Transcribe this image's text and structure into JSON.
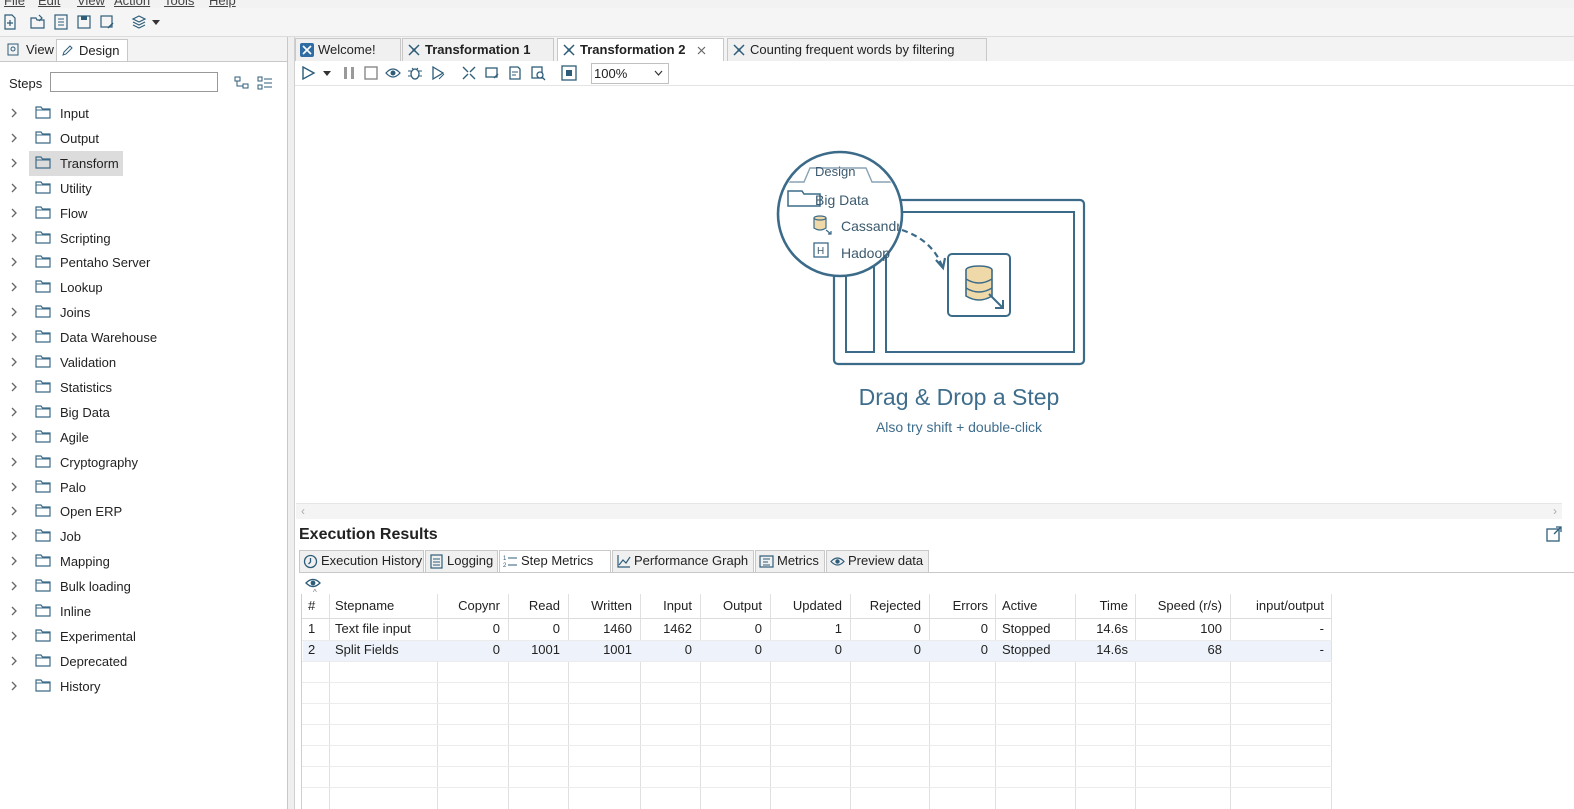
{
  "menu": [
    "File",
    "Edit",
    "View",
    "Action",
    "Tools",
    "Help"
  ],
  "left_panel": {
    "tabs": [
      {
        "label": "View"
      },
      {
        "label": "Design"
      }
    ],
    "steps_label": "Steps",
    "search_value": "",
    "tree": [
      {
        "label": "Input"
      },
      {
        "label": "Output"
      },
      {
        "label": "Transform",
        "selected": true
      },
      {
        "label": "Utility"
      },
      {
        "label": "Flow"
      },
      {
        "label": "Scripting"
      },
      {
        "label": "Pentaho Server"
      },
      {
        "label": "Lookup"
      },
      {
        "label": "Joins"
      },
      {
        "label": "Data Warehouse"
      },
      {
        "label": "Validation"
      },
      {
        "label": "Statistics"
      },
      {
        "label": "Big Data"
      },
      {
        "label": "Agile"
      },
      {
        "label": "Cryptography"
      },
      {
        "label": "Palo"
      },
      {
        "label": "Open ERP"
      },
      {
        "label": "Job"
      },
      {
        "label": "Mapping"
      },
      {
        "label": "Bulk loading"
      },
      {
        "label": "Inline"
      },
      {
        "label": "Experimental"
      },
      {
        "label": "Deprecated"
      },
      {
        "label": "History"
      }
    ]
  },
  "doc_tabs": [
    {
      "label": "Welcome!"
    },
    {
      "label": "Transformation 1"
    },
    {
      "label": "Transformation 2",
      "active": true,
      "closable": true
    },
    {
      "label": "Counting frequent words by filtering"
    }
  ],
  "canvas_toolbar": {
    "zoom": "100%"
  },
  "canvas": {
    "illustration": {
      "design_tab": "Design",
      "folder": "Big Data",
      "item1": "Cassandr",
      "item2": "Hadoop",
      "item2_badge": "H"
    },
    "drop_title": "Drag & Drop a Step",
    "drop_hint": "Also try shift + double-click"
  },
  "execution": {
    "title": "Execution Results",
    "tabs": [
      {
        "label": "Execution History"
      },
      {
        "label": "Logging"
      },
      {
        "label": "Step Metrics",
        "active": true
      },
      {
        "label": "Performance Graph"
      },
      {
        "label": "Metrics"
      },
      {
        "label": "Preview data"
      }
    ],
    "columns": [
      "#",
      "Stepname",
      "Copynr",
      "Read",
      "Written",
      "Input",
      "Output",
      "Updated",
      "Rejected",
      "Errors",
      "Active",
      "Time",
      "Speed (r/s)",
      "input/output"
    ],
    "rows": [
      [
        "1",
        "Text file input",
        "0",
        "0",
        "1460",
        "1462",
        "0",
        "1",
        "0",
        "0",
        "Stopped",
        "14.6s",
        "100",
        "-"
      ],
      [
        "2",
        "Split Fields",
        "0",
        "1001",
        "1001",
        "0",
        "0",
        "0",
        "0",
        "0",
        "Stopped",
        "14.6s",
        "68",
        "-"
      ]
    ]
  }
}
